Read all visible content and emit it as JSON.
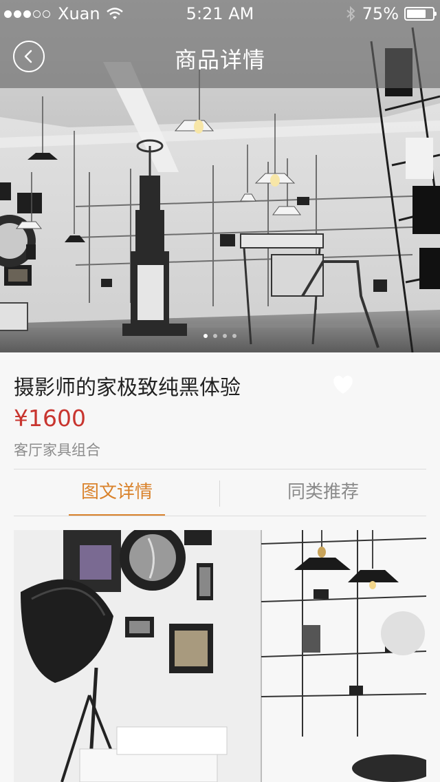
{
  "status_bar": {
    "carrier": "Xuan",
    "time": "5:21 AM",
    "battery_percent": "75%",
    "battery_level": 0.75,
    "signal_bars_filled": 3,
    "signal_bars_total": 5,
    "icons": [
      "wifi-icon",
      "bluetooth-icon",
      "battery-icon"
    ]
  },
  "nav": {
    "title": "商品详情",
    "back_icon": "chevron-left-icon"
  },
  "carousel": {
    "page_count": 4,
    "active_index": 0
  },
  "product": {
    "title": "摄影师的家极致纯黑体验",
    "price": "¥1600",
    "category": "客厅家具组合",
    "favorite_icon": "heart-icon"
  },
  "tabs": [
    {
      "label": "图文详情",
      "active": true
    },
    {
      "label": "同类推荐",
      "active": false
    }
  ],
  "colors": {
    "accent": "#d9822b",
    "price": "#c8352f",
    "text": "#222222",
    "muted": "#8c8c8c",
    "background": "#f7f7f7"
  }
}
